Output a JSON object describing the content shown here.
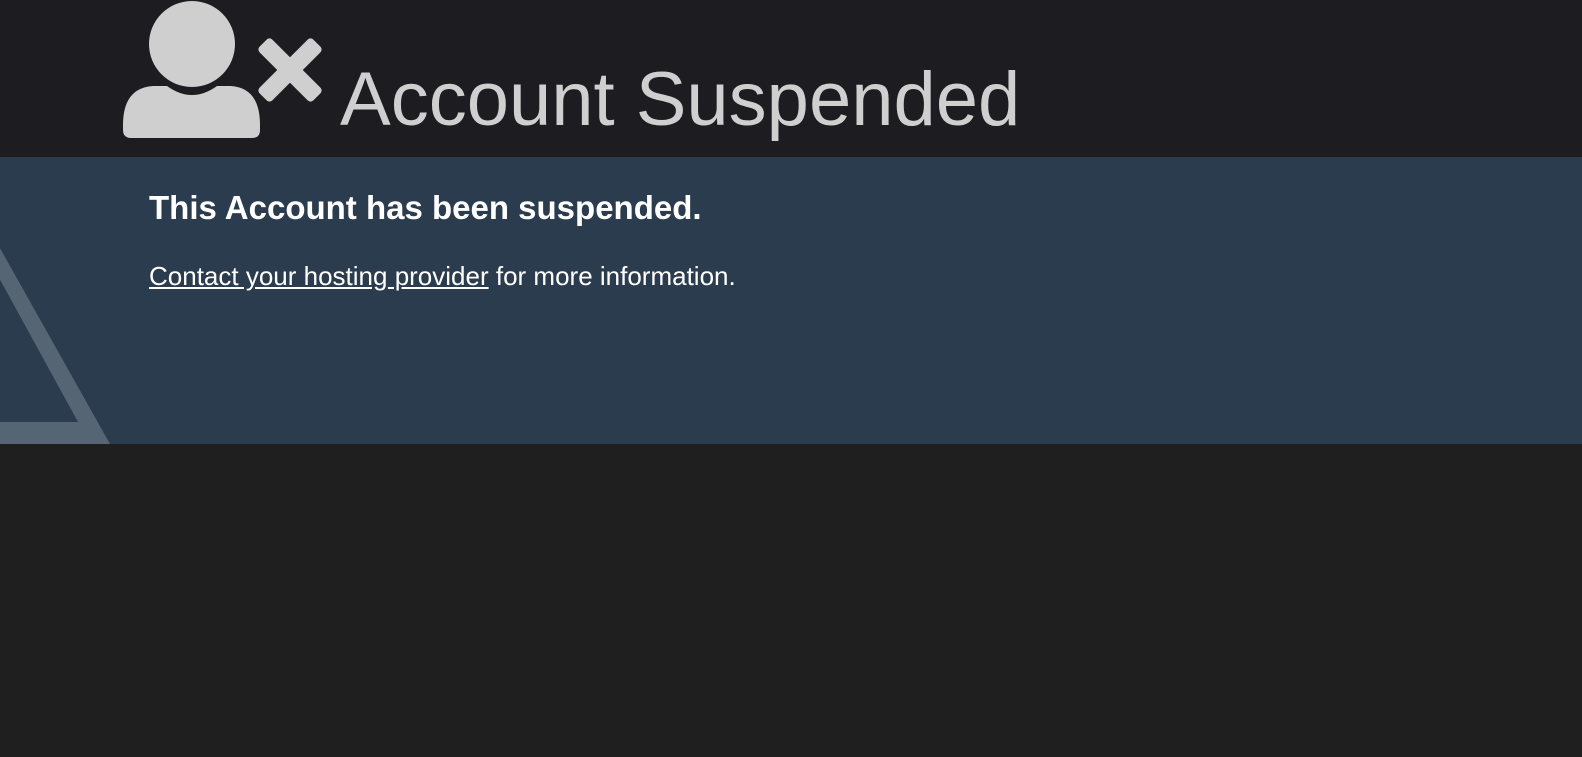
{
  "header": {
    "title": "Account Suspended",
    "icon": "user-remove-icon"
  },
  "message": {
    "heading": "This Account has been suspended.",
    "link_text": "Contact your hosting provider",
    "trailing_text": " for more information.",
    "decoration_icon": "warning-triangle-icon"
  },
  "colors": {
    "header_bg": "#1d1c20",
    "panel_bg": "#2b3c4e",
    "page_bg": "#1f1f1f",
    "title_color": "#cfcfcf",
    "text_color": "#ffffff",
    "triangle_color": "#5a6978"
  }
}
